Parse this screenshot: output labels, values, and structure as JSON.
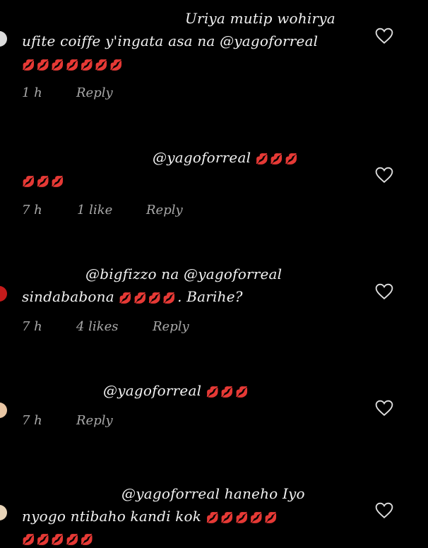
{
  "comments": [
    {
      "lines": [
        "Uriya mutip wohirya",
        "ufite coiffe y'ingata asa na @yagoforreal"
      ],
      "emoji_line": "💋💋💋💋💋💋💋",
      "time": "1 h",
      "likes": "",
      "reply": "Reply"
    },
    {
      "lines": [
        "@yagoforreal"
      ],
      "emoji_inline": "💋💋💋",
      "emoji_line": "💋💋💋",
      "time": "7 h",
      "likes": "1 like",
      "reply": "Reply"
    },
    {
      "lines": [
        "@bigfizzo na @yagoforreal",
        "sindababona"
      ],
      "emoji_inline": "💋💋💋💋",
      "tail": ". Barihe?",
      "time": "7 h",
      "likes": "4 likes",
      "reply": "Reply"
    },
    {
      "lines": [
        "@yagoforreal"
      ],
      "emoji_inline": "💋💋💋",
      "time": "7 h",
      "likes": "",
      "reply": "Reply"
    },
    {
      "lines": [
        "@yagoforreal  haneho Iyo",
        "nyogo ntibaho kandi kok"
      ],
      "emoji_inline": "💋💋💋💋💋",
      "emoji_line": "💋💋💋💋💋",
      "time": "",
      "likes": "",
      "reply": ""
    }
  ],
  "icons": {
    "like": "heart-outline-icon",
    "emoji": "kiss-lips-emoji"
  },
  "colors": {
    "background": "#000000",
    "text": "#f2f2f2",
    "meta": "#a8a8a8",
    "emoji": "#d63fd6"
  }
}
